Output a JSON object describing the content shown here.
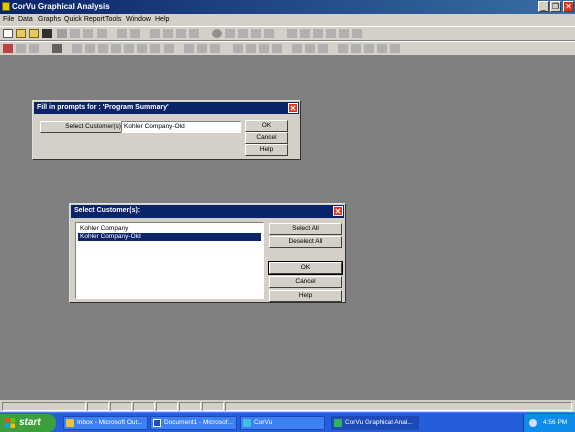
{
  "app": {
    "title": "CorVu Graphical Analysis"
  },
  "window_buttons": {
    "minimize": "_",
    "restore": "❐",
    "close": "✕"
  },
  "menu": [
    {
      "label": "File"
    },
    {
      "label": "Data"
    },
    {
      "label": "Graphs"
    },
    {
      "label": "Quick Report"
    },
    {
      "label": "Tools"
    },
    {
      "label": "Window"
    },
    {
      "label": "Help"
    }
  ],
  "prompt_dialog": {
    "title": "Fill in prompts for : 'Program Summary'",
    "prompt_button": "Select Customer(s):",
    "prompt_value": "Kohler Company-Old",
    "ok": "OK",
    "cancel": "Cancel",
    "help": "Help",
    "close": "✕"
  },
  "select_dialog": {
    "title": "Select Customer(s):",
    "items": [
      {
        "label": "Kohler Company",
        "selected": false
      },
      {
        "label": "Kohler Company-Old",
        "selected": true
      }
    ],
    "select_all": "Select All",
    "deselect_all": "Deselect All",
    "ok": "OK",
    "cancel": "Cancel",
    "help": "Help",
    "close": "✕"
  },
  "taskbar": {
    "start": "start",
    "tasks": [
      {
        "label": "Inbox - Microsoft Out...",
        "active": false
      },
      {
        "label": "Document1 - Microsof...",
        "active": false
      },
      {
        "label": "CorVu",
        "active": false
      },
      {
        "label": "CorVu Graphical Anal...",
        "active": true
      }
    ],
    "clock": "4:56 PM"
  }
}
